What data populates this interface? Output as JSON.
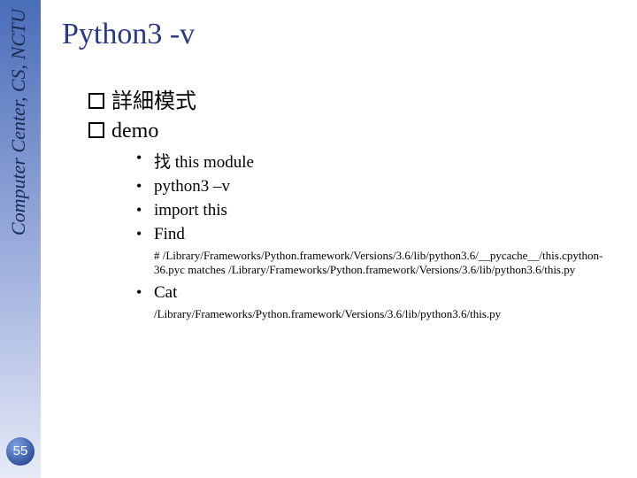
{
  "sidebar": {
    "label": "Computer Center, CS, NCTU",
    "page_number": "55"
  },
  "title": "Python3 -v",
  "outline": [
    "詳細模式",
    "demo"
  ],
  "sub": {
    "item1": "找 this module",
    "item2": "python3 –v",
    "item3": "import this",
    "item4": "Find",
    "note4": "# /Library/Frameworks/Python.framework/Versions/3.6/lib/python3.6/__pycache__/this.cpython-36.pyc matches /Library/Frameworks/Python.framework/Versions/3.6/lib/python3.6/this.py",
    "item5": "Cat",
    "note5": "/Library/Frameworks/Python.framework/Versions/3.6/lib/python3.6/this.py"
  }
}
